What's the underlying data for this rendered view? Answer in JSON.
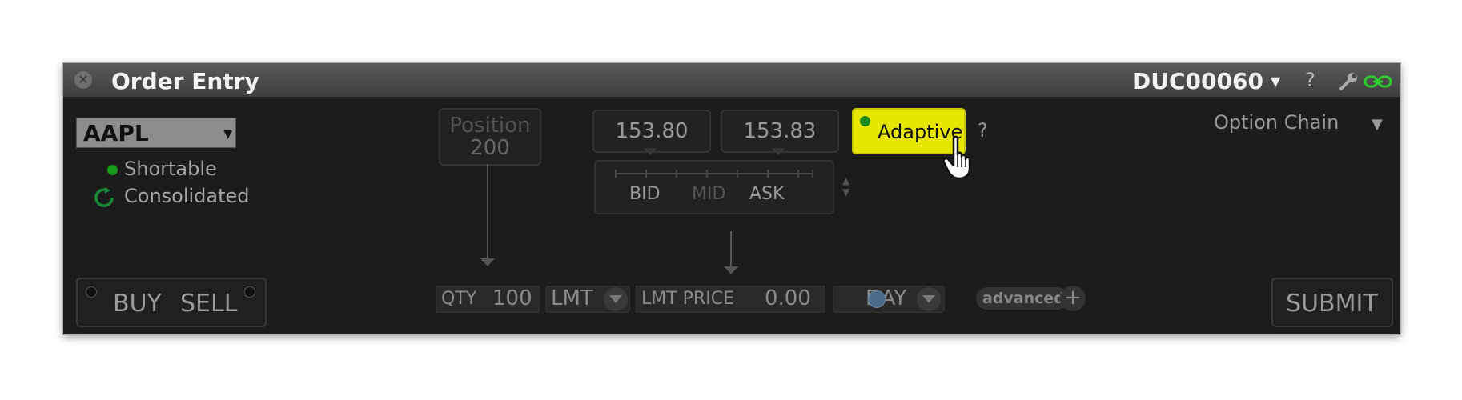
{
  "window": {
    "title": "Order Entry",
    "account": "DUC00060",
    "help": "?"
  },
  "symbol": {
    "value": "AAPL"
  },
  "status": {
    "shortable": "Shortable",
    "consolidated": "Consolidated"
  },
  "position": {
    "label": "Position",
    "value": "200"
  },
  "quote": {
    "bid": "153.80",
    "ask": "153.83",
    "bid_label": "BID",
    "mid_label": "MID",
    "ask_label": "ASK"
  },
  "algo": {
    "label": "Adaptive",
    "help": "?"
  },
  "option_chain": {
    "label": "Option Chain"
  },
  "order": {
    "buy": "BUY",
    "sell": "SELL",
    "qty_label": "QTY",
    "qty_value": "100",
    "order_type": "LMT",
    "lmt_price_label": "LMT PRICE",
    "lmt_price_value": "0.00",
    "tif": "DAY",
    "advanced": "advanced",
    "submit": "SUBMIT"
  },
  "colors": {
    "accent_yellow": "#e6e600",
    "status_green": "#1a9a1a",
    "link_green": "#2ecc2e"
  }
}
